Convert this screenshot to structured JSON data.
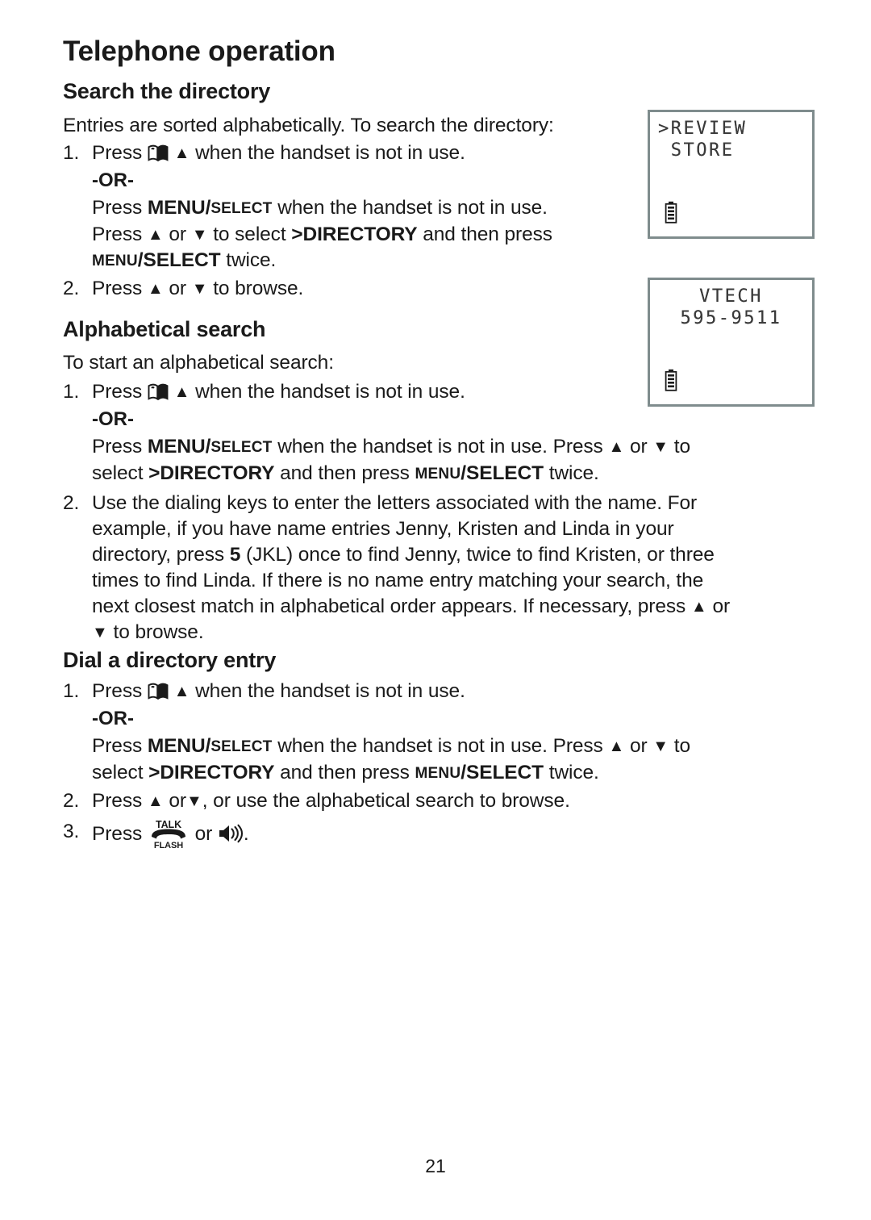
{
  "document": {
    "chapter_title": "Telephone operation",
    "page_number": "21"
  },
  "sections": [
    {
      "heading": "Search the directory",
      "intro": "Entries are sorted alphabetically. To search the directory:",
      "steps": {
        "s1_num": "1.",
        "s1_press": "Press",
        "s1_tail": "when the handset is not in use.",
        "or": "-OR-",
        "alt_press": "Press",
        "alt_menu_big": "MENU/",
        "alt_menu_small": "SELECT",
        "alt_tail": "when the handset is not in use.",
        "alt2_press": "Press",
        "alt2_mid": "or",
        "alt2_to_select": "to select",
        "alt2_directory": ">DIRECTORY",
        "alt2_and_then": "and then press",
        "alt2_menu_small": "MENU",
        "alt2_select_big": "/SELECT",
        "alt2_twice": "twice.",
        "s2_num": "2.",
        "s2_press": "Press",
        "s2_or": "or",
        "s2_tail": "to browse."
      }
    },
    {
      "heading": "Alphabetical search",
      "intro": "To start an alphabetical search:",
      "steps": {
        "s1_num": "1.",
        "s1_press": "Press",
        "s1_tail": "when the handset is not in use.",
        "or": "-OR-",
        "alt_press": "Press",
        "alt_menu_big": "MENU/",
        "alt_menu_small": "SELECT",
        "alt_mid": "when the handset is not in use. Press",
        "alt_or": "or",
        "alt_to": "to",
        "alt2_select": "select",
        "alt2_directory": ">DIRECTORY",
        "alt2_and_then": "and then press",
        "alt2_menu_small": "MENU",
        "alt2_select_big": "/SELECT",
        "alt2_twice": "twice.",
        "s2_num": "2.",
        "s2_line1": "Use the dialing keys to enter the letters associated with the name. For",
        "s2_line2": "example, if you have name entries Jenny, Kristen and Linda in your",
        "s2_line3a": "directory, press",
        "s2_line3_key": "5",
        "s2_line3b": "(JKL) once to find Jenny, twice to find Kristen, or three",
        "s2_line4": "times to find Linda. If there is no name entry matching your search, the",
        "s2_line5a": "next closest match in alphabetical order appears. If necessary, press",
        "s2_line5b": "or",
        "s2_line6": "to browse."
      }
    },
    {
      "heading": "Dial a directory entry",
      "steps": {
        "s1_num": "1.",
        "s1_press": "Press",
        "s1_tail": "when the handset is not in use.",
        "or": "-OR-",
        "alt_press": "Press",
        "alt_menu_big": "MENU/",
        "alt_menu_small": "SELECT",
        "alt_mid": "when the handset is not in use. Press",
        "alt_or": "or",
        "alt_to": "to",
        "alt2_select": "select",
        "alt2_directory": ">DIRECTORY",
        "alt2_and_then": "and then press",
        "alt2_menu_small": "MENU",
        "alt2_select_big": "/SELECT",
        "alt2_twice": "twice.",
        "s2_num": "2.",
        "s2_press": "Press",
        "s2_or": "or",
        "s2_tail": ", or use the alphabetical search to browse.",
        "s3_num": "3.",
        "s3_press": "Press",
        "s3_or": "or",
        "s3_tail": "."
      }
    }
  ],
  "lcd_screens": [
    {
      "name": "review-store-screen",
      "line1": ">REVIEW",
      "line2": " STORE",
      "battery_icon": "battery-icon"
    },
    {
      "name": "directory-entry-screen",
      "line1": "VTECH",
      "line2": "595-9511",
      "battery_icon": "battery-icon"
    }
  ],
  "icons": {
    "directory_book": "directory-book-icon",
    "up_triangle": "▲",
    "down_triangle": "▼",
    "talk_label": "TALK",
    "flash_label": "FLASH",
    "talk_flash": "talk-flash-icon",
    "speaker": "speaker-icon"
  },
  "colors": {
    "text": "#1a1a1a",
    "lcd_border": "#7f8c8d",
    "lcd_text": "#3a3a3a",
    "background": "#ffffff"
  }
}
